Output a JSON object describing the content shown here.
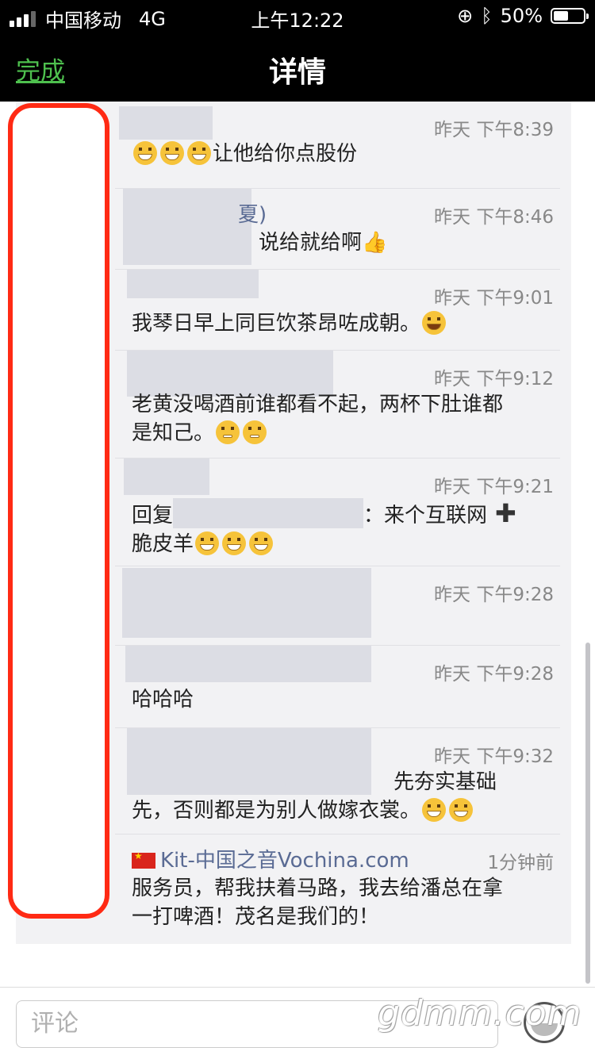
{
  "status_bar": {
    "carrier": "中国移动",
    "network": "4G",
    "time": "上午12:22",
    "battery": "50%",
    "battery_level": 0.5
  },
  "nav": {
    "done_label": "完成",
    "title": "详情"
  },
  "comments": [
    {
      "time": "昨天 下午8:39",
      "text": "让他给你点股份",
      "emojis_before": 3
    },
    {
      "name_fragment": "夏)",
      "time": "昨天 下午8:46",
      "text": "说给就给啊"
    },
    {
      "time": "昨天 下午9:01",
      "text": "我琴日早上同巨饮茶昂咗成朝。"
    },
    {
      "time": "昨天 下午9:12",
      "line1": "老黄没喝酒前谁都看不起，两杯下肚谁都",
      "line2": "是知己。"
    },
    {
      "time": "昨天 下午9:21",
      "prefix": "回复",
      "text": "：来个互联网",
      "line2": "脆皮羊"
    },
    {
      "time": "昨天 下午9:28",
      "text": ""
    },
    {
      "time": "昨天 下午9:28",
      "text": "哈哈哈"
    },
    {
      "time": "昨天 下午9:32",
      "line1": "先夯实基础",
      "line2": "先，否则都是为别人做嫁衣裳。"
    },
    {
      "name": "Kit-中国之音Vochina.com",
      "time": "1分钟前",
      "line1": "服务员，帮我扶着马路，我去给潘总在拿",
      "line2": "一打啤酒！茂名是我们的！"
    }
  ],
  "input": {
    "placeholder": "评论"
  },
  "watermark": "gdmm.com",
  "colors": {
    "accent_green": "#4ec04e",
    "highlight_red": "#ff2a14",
    "link_blue": "#5a6b94"
  },
  "icons": [
    "signal-icon",
    "lock-rotation-icon",
    "bluetooth-icon",
    "battery-icon",
    "emoji-icon",
    "china-flag-icon",
    "thumbs-up-icon",
    "plus-icon"
  ]
}
